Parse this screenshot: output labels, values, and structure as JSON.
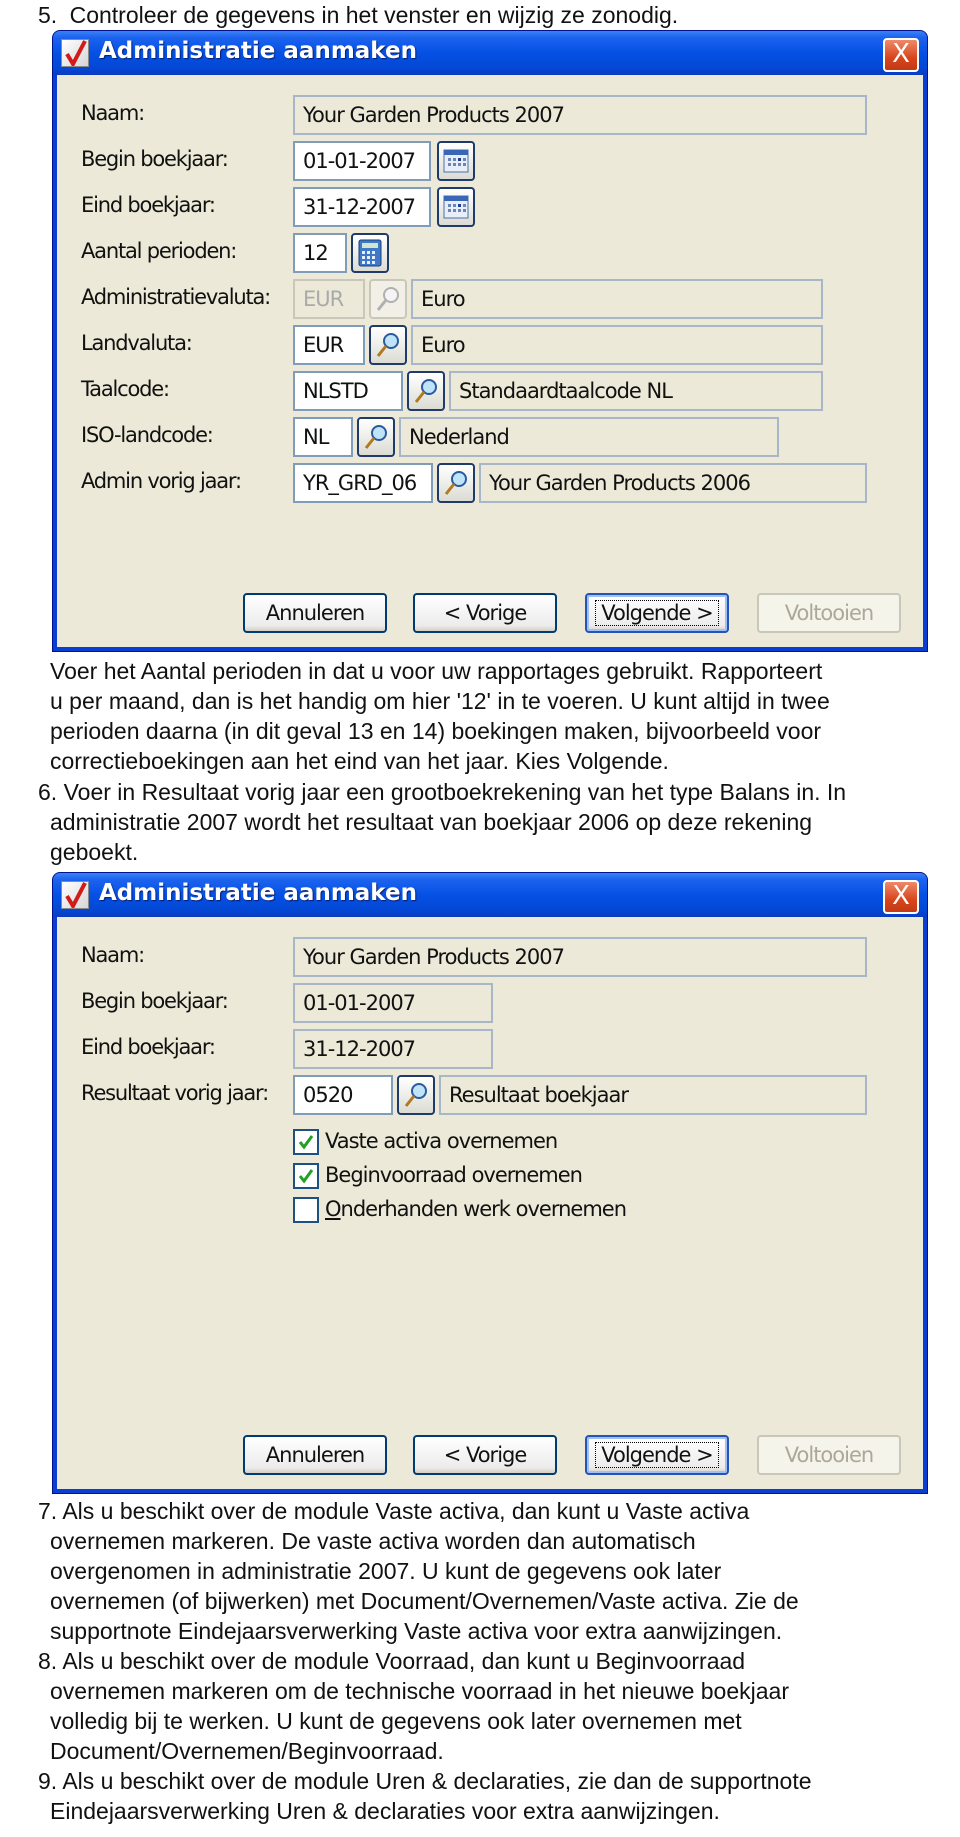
{
  "steps": {
    "step5": {
      "number": "5.",
      "text": "Controleer de gegevens in het venster en wijzig ze zonodig.",
      "after_lines": [
        "Voer het Aantal perioden in dat u voor uw rapportages gebruikt. Rapporteert",
        "u per maand, dan is het handig om hier '12' in te voeren. U kunt altijd in twee",
        "perioden daarna (in dit geval 13 en 14) boekingen maken, bijvoorbeeld voor",
        "correctieboekingen aan het eind van het jaar. Kies Volgende."
      ]
    },
    "step6": {
      "number": "6.",
      "lines": [
        "Voer in Resultaat vorig jaar een grootboekrekening van het type Balans in. In",
        "administratie 2007 wordt het resultaat van boekjaar 2006 op deze rekening",
        "geboekt."
      ]
    },
    "step7": {
      "number": "7.",
      "lines": [
        "Als u beschikt over de module Vaste activa, dan kunt u Vaste activa",
        "overnemen markeren. De vaste activa worden dan automatisch",
        "overgenomen in administratie 2007. U kunt de gegevens ook later",
        "overnemen (of bijwerken) met Document/Overnemen/Vaste activa. Zie de",
        "supportnote Eindejaarsverwerking Vaste activa voor extra aanwijzingen."
      ]
    },
    "step8": {
      "number": "8.",
      "lines": [
        "Als u beschikt over de module Voorraad, dan kunt u Beginvoorraad",
        "overnemen markeren om de technische voorraad in het nieuwe boekjaar",
        "volledig bij te werken. U kunt de gegevens ook later overnemen met",
        "Document/Overnemen/Beginvoorraad."
      ]
    },
    "step9": {
      "number": "9.",
      "lines": [
        "Als u beschikt over de module Uren & declaraties, zie dan de supportnote",
        "Eindejaarsverwerking Uren & declaraties voor extra aanwijzingen."
      ]
    }
  },
  "dialog1": {
    "title": "Administratie aanmaken",
    "close": "X",
    "labels": {
      "naam": "Naam:",
      "begin": "Begin boekjaar:",
      "eind": "Eind boekjaar:",
      "perioden": "Aantal perioden:",
      "adminvaluta": "Administratievaluta:",
      "landvaluta": "Landvaluta:",
      "taalcode": "Taalcode:",
      "isoland": "ISO-landcode:",
      "adminvorig": "Admin vorig jaar:"
    },
    "values": {
      "naam": "Your Garden Products 2007",
      "begin": "01-01-2007",
      "eind": "31-12-2007",
      "perioden": "12",
      "adminvaluta_code": "EUR",
      "adminvaluta_desc": "Euro",
      "landvaluta_code": "EUR",
      "landvaluta_desc": "Euro",
      "taalcode_code": "NLSTD",
      "taalcode_desc": "Standaardtaalcode NL",
      "isoland_code": "NL",
      "isoland_desc": "Nederland",
      "adminvorig_code": "YR_GRD_06",
      "adminvorig_desc": "Your Garden Products 2006"
    },
    "buttons": {
      "cancel": "Annuleren",
      "prev": "< Vorige",
      "next": "Volgende >",
      "finish": "Voltooien"
    }
  },
  "dialog2": {
    "title": "Administratie aanmaken",
    "close": "X",
    "labels": {
      "naam": "Naam:",
      "begin": "Begin boekjaar:",
      "eind": "Eind boekjaar:",
      "resultaat": "Resultaat vorig jaar:"
    },
    "values": {
      "naam": "Your Garden Products 2007",
      "begin": "01-01-2007",
      "eind": "31-12-2007",
      "resultaat_code": "0520",
      "resultaat_desc": "Resultaat boekjaar"
    },
    "checkboxes": [
      {
        "label": "Vaste activa overnemen",
        "checked": true
      },
      {
        "label": "Beginvoorraad overnemen",
        "checked": true
      },
      {
        "label": "Onderhanden werk overnemen",
        "checked": false
      }
    ],
    "buttons": {
      "cancel": "Annuleren",
      "prev": "< Vorige",
      "next": "Volgende >",
      "finish": "Voltooien"
    }
  },
  "colors": {
    "titlebar": "#0551e4",
    "client": "#ece9d8",
    "field_border": "#7f9db9",
    "close": "#d8451c",
    "check": "#21a121"
  }
}
